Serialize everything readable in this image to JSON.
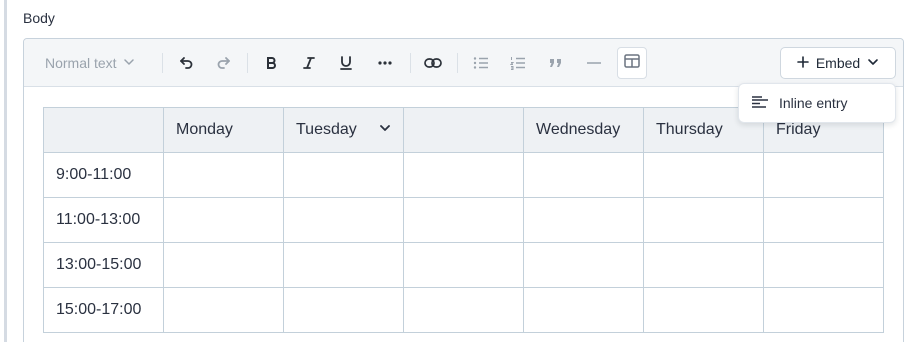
{
  "field": {
    "label": "Body"
  },
  "toolbar": {
    "text_style": "Normal text",
    "buttons": [
      "undo-icon",
      "redo-icon",
      "bold-icon",
      "italic-icon",
      "underline-icon",
      "more-icon",
      "link-icon",
      "bullet-list-icon",
      "numbered-list-icon",
      "quote-icon",
      "horizontal-rule-icon",
      "table-icon"
    ],
    "embed_label": "Embed"
  },
  "embed_menu": {
    "items": [
      {
        "label": "Inline entry",
        "icon": "inline-entry-icon"
      }
    ]
  },
  "table": {
    "headers": [
      "",
      "Monday",
      "Tuesday",
      "",
      "Wednesday",
      "Thursday",
      "Friday"
    ],
    "rows": [
      [
        "9:00-11:00",
        "",
        "",
        "",
        "",
        "",
        ""
      ],
      [
        "11:00-13:00",
        "",
        "",
        "",
        "",
        "",
        ""
      ],
      [
        "13:00-15:00",
        "",
        "",
        "",
        "",
        "",
        ""
      ],
      [
        "15:00-17:00",
        "",
        "",
        "",
        "",
        "",
        ""
      ]
    ]
  },
  "colors": {
    "border": "#c3d0da",
    "header_bg": "#eef1f4",
    "toolbar_bg": "#f4f6f8"
  }
}
